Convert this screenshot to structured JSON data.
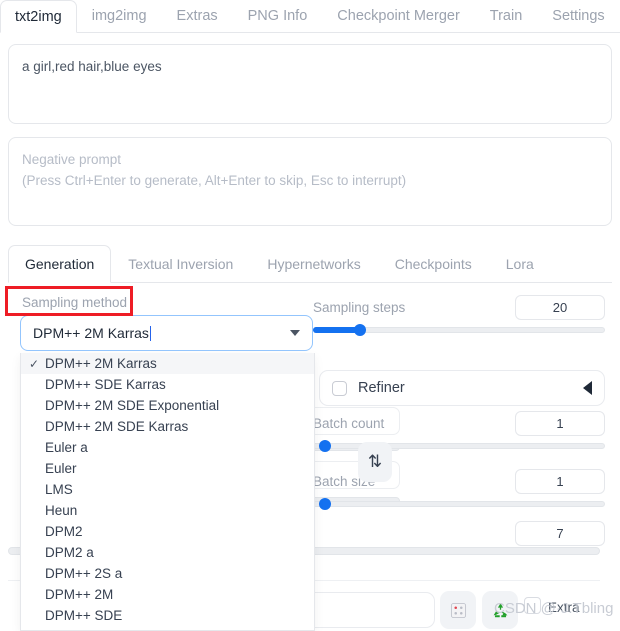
{
  "top_tabs": [
    {
      "label": "txt2img",
      "active": true
    },
    {
      "label": "img2img",
      "active": false
    },
    {
      "label": "Extras",
      "active": false
    },
    {
      "label": "PNG Info",
      "active": false
    },
    {
      "label": "Checkpoint Merger",
      "active": false
    },
    {
      "label": "Train",
      "active": false
    },
    {
      "label": "Settings",
      "active": false
    }
  ],
  "prompt": {
    "value": "a girl,red hair,blue eyes"
  },
  "negative_prompt": {
    "placeholder_line1": "Negative prompt",
    "placeholder_line2": "(Press Ctrl+Enter to generate, Alt+Enter to skip, Esc to interrupt)"
  },
  "sub_tabs": [
    {
      "label": "Generation",
      "active": true
    },
    {
      "label": "Textual Inversion",
      "active": false
    },
    {
      "label": "Hypernetworks",
      "active": false
    },
    {
      "label": "Checkpoints",
      "active": false
    },
    {
      "label": "Lora",
      "active": false
    }
  ],
  "sampling_method": {
    "label": "Sampling method",
    "value": "DPM++ 2M Karras",
    "highlight_color": "#ee1c25",
    "options": [
      {
        "label": "DPM++ 2M Karras",
        "selected": true
      },
      {
        "label": "DPM++ SDE Karras",
        "selected": false
      },
      {
        "label": "DPM++ 2M SDE Exponential",
        "selected": false
      },
      {
        "label": "DPM++ 2M SDE Karras",
        "selected": false
      },
      {
        "label": "Euler a",
        "selected": false
      },
      {
        "label": "Euler",
        "selected": false
      },
      {
        "label": "LMS",
        "selected": false
      },
      {
        "label": "Heun",
        "selected": false
      },
      {
        "label": "DPM2",
        "selected": false
      },
      {
        "label": "DPM2 a",
        "selected": false
      },
      {
        "label": "DPM++ 2S a",
        "selected": false
      },
      {
        "label": "DPM++ 2M",
        "selected": false
      },
      {
        "label": "DPM++ SDE",
        "selected": false
      }
    ],
    "check_glyph": "✓",
    "arrow_glyph": "dropdown-caret"
  },
  "sampling_steps": {
    "label": "Sampling steps",
    "value": "20",
    "fill_percent": 16
  },
  "refiner": {
    "label": "Refiner",
    "checked": false,
    "collapse_glyph": "triangle-left"
  },
  "batch_count": {
    "label": "Batch count",
    "value": "1",
    "fill_percent": 2
  },
  "batch_size": {
    "label": "Batch size",
    "value": "1",
    "fill_percent": 2
  },
  "cfg_scale": {
    "value": "7",
    "fill_percent": 0
  },
  "swap_button": {
    "glyph": "⇅",
    "icon_name": "swap-dimensions-icon"
  },
  "seed_controls": {
    "dice_icon": "dice-icon",
    "recycle_icon": "recycle-icon",
    "extra_label": "Extra",
    "extra_checked": false
  },
  "watermark": {
    "text": "CSDN @·J.Tbling"
  },
  "colors": {
    "accent_blue": "#1471f0",
    "highlight_red": "#ee1c25",
    "recycle_green": "#22a02a",
    "muted_text": "#9ca3af"
  }
}
